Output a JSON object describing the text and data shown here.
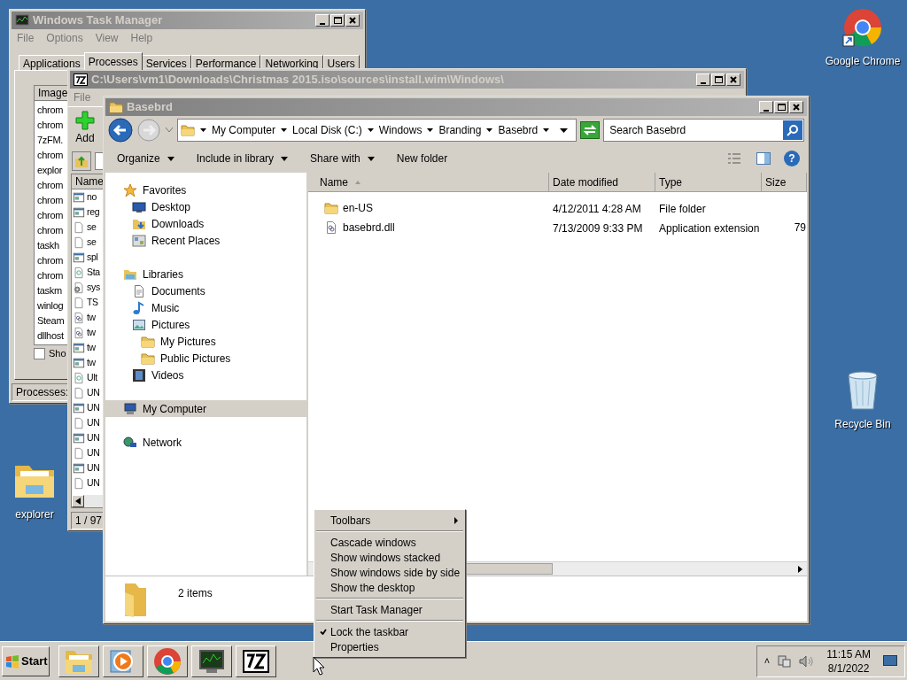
{
  "desktop_icons": [
    {
      "label": "Google Chrome",
      "kind": "browser"
    },
    {
      "label": "Recycle Bin",
      "kind": "trash"
    },
    {
      "label": "explorer",
      "kind": "folder"
    }
  ],
  "task_manager": {
    "title": "Windows Task Manager",
    "menu": [
      "File",
      "Options",
      "View",
      "Help"
    ],
    "tabs": [
      {
        "label": "Applications",
        "selected": false
      },
      {
        "label": "Processes",
        "selected": true
      },
      {
        "label": "Services",
        "selected": false
      },
      {
        "label": "Performance",
        "selected": false
      },
      {
        "label": "Networking",
        "selected": false
      },
      {
        "label": "Users",
        "selected": false
      }
    ],
    "column": "Image",
    "rows": [
      "chrom",
      "chrom",
      "7zFM.",
      "chrom",
      "explor",
      "chrom",
      "chrom",
      "chrom",
      "chrom",
      "taskh",
      "chrom",
      "chrom",
      "taskm",
      "winlog",
      "Steam",
      "dllhost"
    ],
    "checkbox": {
      "label": "Sho",
      "checked": false
    },
    "status": "Processes:"
  },
  "archive_window": {
    "title": "C:\\Users\\vm1\\Downloads\\Christmas 2015.iso\\sources\\install.wim\\Windows\\",
    "menu": [
      "File"
    ],
    "add_button": "Add",
    "column": "Name",
    "rows": [
      {
        "name": "no",
        "kind": "app"
      },
      {
        "name": "reg",
        "kind": "app"
      },
      {
        "name": "se",
        "kind": "doc"
      },
      {
        "name": "se",
        "kind": "doc"
      },
      {
        "name": "spl",
        "kind": "app"
      },
      {
        "name": "Sta",
        "kind": "config"
      },
      {
        "name": "sys",
        "kind": "gear"
      },
      {
        "name": "TS",
        "kind": "doc"
      },
      {
        "name": "tw",
        "kind": "dll"
      },
      {
        "name": "tw",
        "kind": "dll"
      },
      {
        "name": "tw",
        "kind": "app"
      },
      {
        "name": "tw",
        "kind": "app"
      },
      {
        "name": "Ult",
        "kind": "config"
      },
      {
        "name": "UN",
        "kind": "doc"
      },
      {
        "name": "UN",
        "kind": "app"
      },
      {
        "name": "UN",
        "kind": "doc"
      },
      {
        "name": "UN",
        "kind": "app"
      },
      {
        "name": "UN",
        "kind": "doc"
      },
      {
        "name": "UN",
        "kind": "app"
      },
      {
        "name": "UN",
        "kind": "doc"
      }
    ],
    "status": "1 / 97"
  },
  "explorer": {
    "title": "Basebrd",
    "breadcrumb": [
      "My Computer",
      "Local Disk (C:)",
      "Windows",
      "Branding",
      "Basebrd"
    ],
    "search": {
      "placeholder": "Search Basebrd"
    },
    "help": "?",
    "toolbar": [
      {
        "label": "Organize",
        "dropdown": true
      },
      {
        "label": "Include in library",
        "dropdown": true
      },
      {
        "label": "Share with",
        "dropdown": true
      },
      {
        "label": "New folder",
        "dropdown": false
      }
    ],
    "nav_pane": [
      {
        "label": "Favorites",
        "kind": "star",
        "selected": false,
        "children": [
          {
            "label": "Desktop",
            "kind": "desktop",
            "selected": false
          },
          {
            "label": "Downloads",
            "kind": "downloads",
            "selected": false
          },
          {
            "label": "Recent Places",
            "kind": "recent",
            "selected": false
          }
        ]
      },
      {
        "label": "Libraries",
        "kind": "library",
        "selected": false,
        "children": [
          {
            "label": "Documents",
            "kind": "document",
            "selected": false
          },
          {
            "label": "Music",
            "kind": "music",
            "selected": false
          },
          {
            "label": "Pictures",
            "kind": "picture",
            "selected": false,
            "children": [
              {
                "label": "My Pictures",
                "kind": "folder",
                "selected": false
              },
              {
                "label": "Public Pictures",
                "kind": "folder",
                "selected": false
              }
            ]
          },
          {
            "label": "Videos",
            "kind": "video",
            "selected": false
          }
        ]
      },
      {
        "label": "My Computer",
        "kind": "computer",
        "selected": true
      },
      {
        "label": "Network",
        "kind": "network",
        "selected": false
      }
    ],
    "columns": [
      "Name",
      "Date modified",
      "Type",
      "Size"
    ],
    "rows": [
      {
        "name": "en-US",
        "kind": "folder",
        "date": "4/12/2011 4:28 AM",
        "type": "File folder"
      },
      {
        "name": "basebrd.dll",
        "kind": "dll",
        "date": "7/13/2009 9:33 PM",
        "type": "Application extension",
        "size": "79"
      }
    ],
    "status": "2 items"
  },
  "context_menu": [
    {
      "kind": "submenu",
      "label": "Toolbars",
      "checked": false
    },
    {
      "kind": "separator"
    },
    {
      "kind": "item",
      "label": "Cascade windows",
      "checked": false
    },
    {
      "kind": "item",
      "label": "Show windows stacked",
      "checked": false
    },
    {
      "kind": "item",
      "label": "Show windows side by side",
      "checked": false
    },
    {
      "kind": "item",
      "label": "Show the desktop",
      "checked": false
    },
    {
      "kind": "separator"
    },
    {
      "kind": "item",
      "label": "Start Task Manager",
      "checked": false
    },
    {
      "kind": "separator"
    },
    {
      "kind": "item",
      "label": "Lock the taskbar",
      "checked": true
    },
    {
      "kind": "item",
      "label": "Properties",
      "checked": false
    }
  ],
  "taskbar": {
    "start": "Start",
    "buttons": [
      {
        "kind": "folder"
      },
      {
        "kind": "media"
      },
      {
        "kind": "browser"
      },
      {
        "kind": "monitor"
      },
      {
        "kind": "archive"
      }
    ],
    "tray": {
      "expand": "˄",
      "time": "11:15 AM",
      "date": "8/1/2022"
    }
  }
}
